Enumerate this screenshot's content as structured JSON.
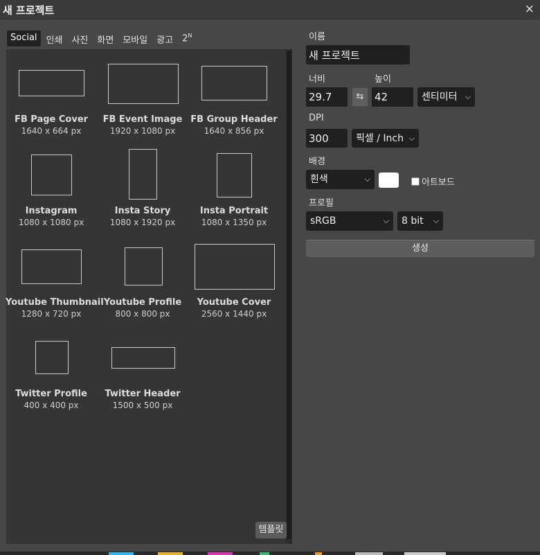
{
  "window": {
    "title": "새 프로젝트",
    "close_icon": "×"
  },
  "tabs": [
    {
      "label": "Social",
      "active": true
    },
    {
      "label": "인쇄"
    },
    {
      "label": "사진"
    },
    {
      "label": "화면"
    },
    {
      "label": "모바일"
    },
    {
      "label": "광고"
    },
    {
      "label": "2",
      "sup": "N"
    }
  ],
  "templates": [
    {
      "name": "FB Page Cover",
      "size": "1640 x 664 px"
    },
    {
      "name": "FB Event Image",
      "size": "1920 x 1080 px"
    },
    {
      "name": "FB Group Header",
      "size": "1640 x 856 px"
    },
    {
      "name": "Instagram",
      "size": "1080 x 1080 px"
    },
    {
      "name": "Insta Story",
      "size": "1080 x 1920 px"
    },
    {
      "name": "Insta Portrait",
      "size": "1080 x 1350 px"
    },
    {
      "name": "Youtube Thumbnail",
      "size": "1280 x 720 px"
    },
    {
      "name": "Youtube Profile",
      "size": "800 x 800 px"
    },
    {
      "name": "Youtube Cover",
      "size": "2560 x 1440 px"
    },
    {
      "name": "Twitter Profile",
      "size": "400 x 400 px"
    },
    {
      "name": "Twitter Header",
      "size": "1500 x 500 px"
    }
  ],
  "template_button": "템플릿",
  "form": {
    "name_label": "이름",
    "name_value": "새 프로젝트",
    "width_label": "너비",
    "width_value": "29.7",
    "height_label": "높이",
    "height_value": "42",
    "swap_icon": "⇆",
    "unit_value": "센티미터",
    "dpi_label": "DPI",
    "dpi_value": "300",
    "dpi_unit_value": "픽셀 / Inch",
    "background_label": "배경",
    "background_value": "흰색",
    "background_color": "#ffffff",
    "artboard_label": "아트보드",
    "artboard_checked": false,
    "profile_label": "프로필",
    "profile_value": "sRGB",
    "bitdepth_value": "8 bit",
    "create_button": "생성"
  }
}
